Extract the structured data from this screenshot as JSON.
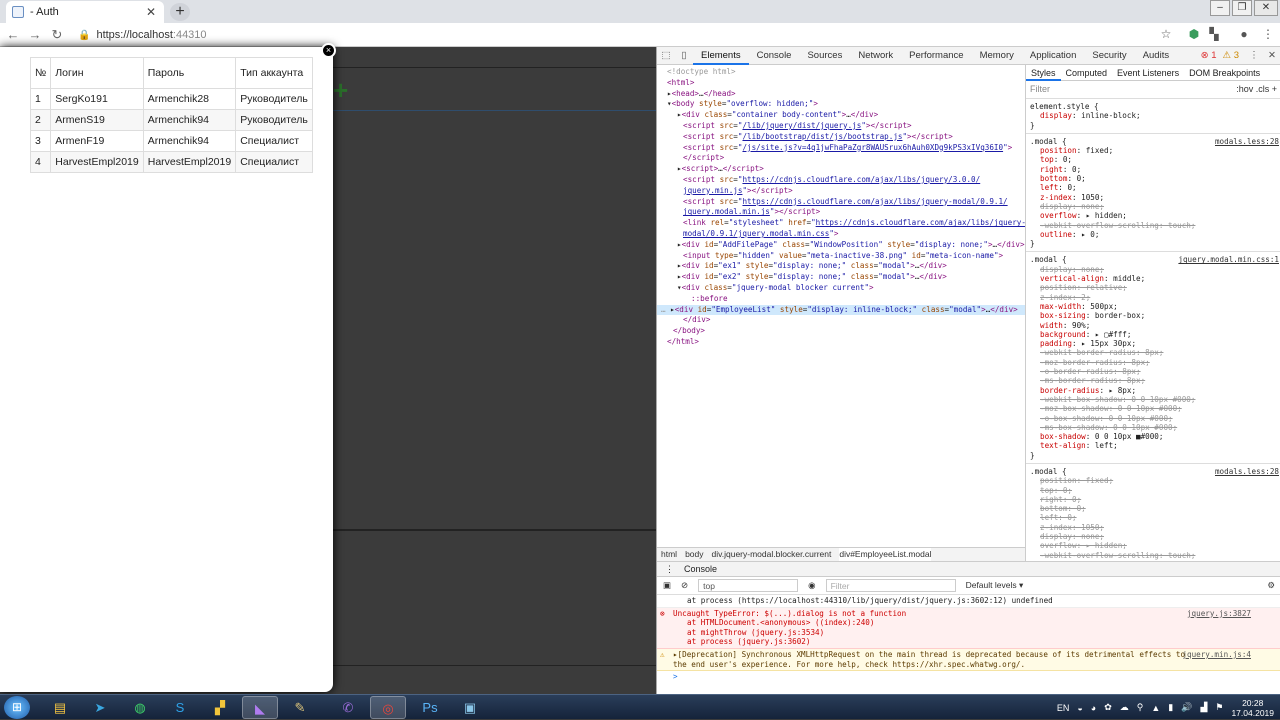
{
  "browser": {
    "tab_title": "- Auth",
    "url_host": "https://localhost",
    "url_port": ":44310"
  },
  "modal": {
    "close_label": "×",
    "table": {
      "headers": [
        "№",
        "Логин",
        "Пароль",
        "Тип аккаунта"
      ],
      "rows": [
        [
          "1",
          "SergKo191",
          "Armenchik28",
          "Руководитель"
        ],
        [
          "2",
          "ArmenS19",
          "Armenchik94",
          "Руководитель"
        ],
        [
          "3",
          "ArmenF19",
          "Armenchik94",
          "Специалист"
        ],
        [
          "4",
          "HarvestEmpl2019",
          "HarvestEmpl2019",
          "Специалист"
        ]
      ]
    }
  },
  "devtools": {
    "tabs": [
      "Elements",
      "Console",
      "Sources",
      "Network",
      "Performance",
      "Memory",
      "Application",
      "Security",
      "Audits"
    ],
    "error_count": "1",
    "warning_count": "3",
    "breadcrumbs": [
      "html",
      "body",
      "div.jquery-modal.blocker.current",
      "div#EmployeeList.modal"
    ],
    "styles_tabs": [
      "Styles",
      "Computed",
      "Event Listeners",
      "DOM Breakpoints"
    ],
    "filter_placeholder": "Filter",
    "filter_tools": ":hov  .cls  +",
    "console_tab": "Console",
    "console_context": "top",
    "console_filter": "Filter",
    "console_levels": "Default levels ▾",
    "console": {
      "l0": "at process (https://localhost:44310/lib/jquery/dist/jquery.js:3602:12) undefined",
      "err_msg": "Uncaught TypeError: $(...).dialog is not a function",
      "err_src": "jquery.js:3827",
      "err_l1": "at HTMLDocument.<anonymous> ((index):240)",
      "err_l2": "at mightThrow (jquery.js:3534)",
      "err_l3": "at process (jquery.js:3602)",
      "warn_msg": "▸[Deprecation] Synchronous XMLHttpRequest on the main thread is deprecated because of its detrimental effects to",
      "warn_msg2": "the end user's experience. For more help, check https://xhr.spec.whatwg.org/.",
      "warn_src": "jquery.min.js:4",
      "prompt": ">"
    }
  },
  "taskbar": {
    "lang": "EN",
    "time": "20:28",
    "date": "17.04.2019"
  }
}
